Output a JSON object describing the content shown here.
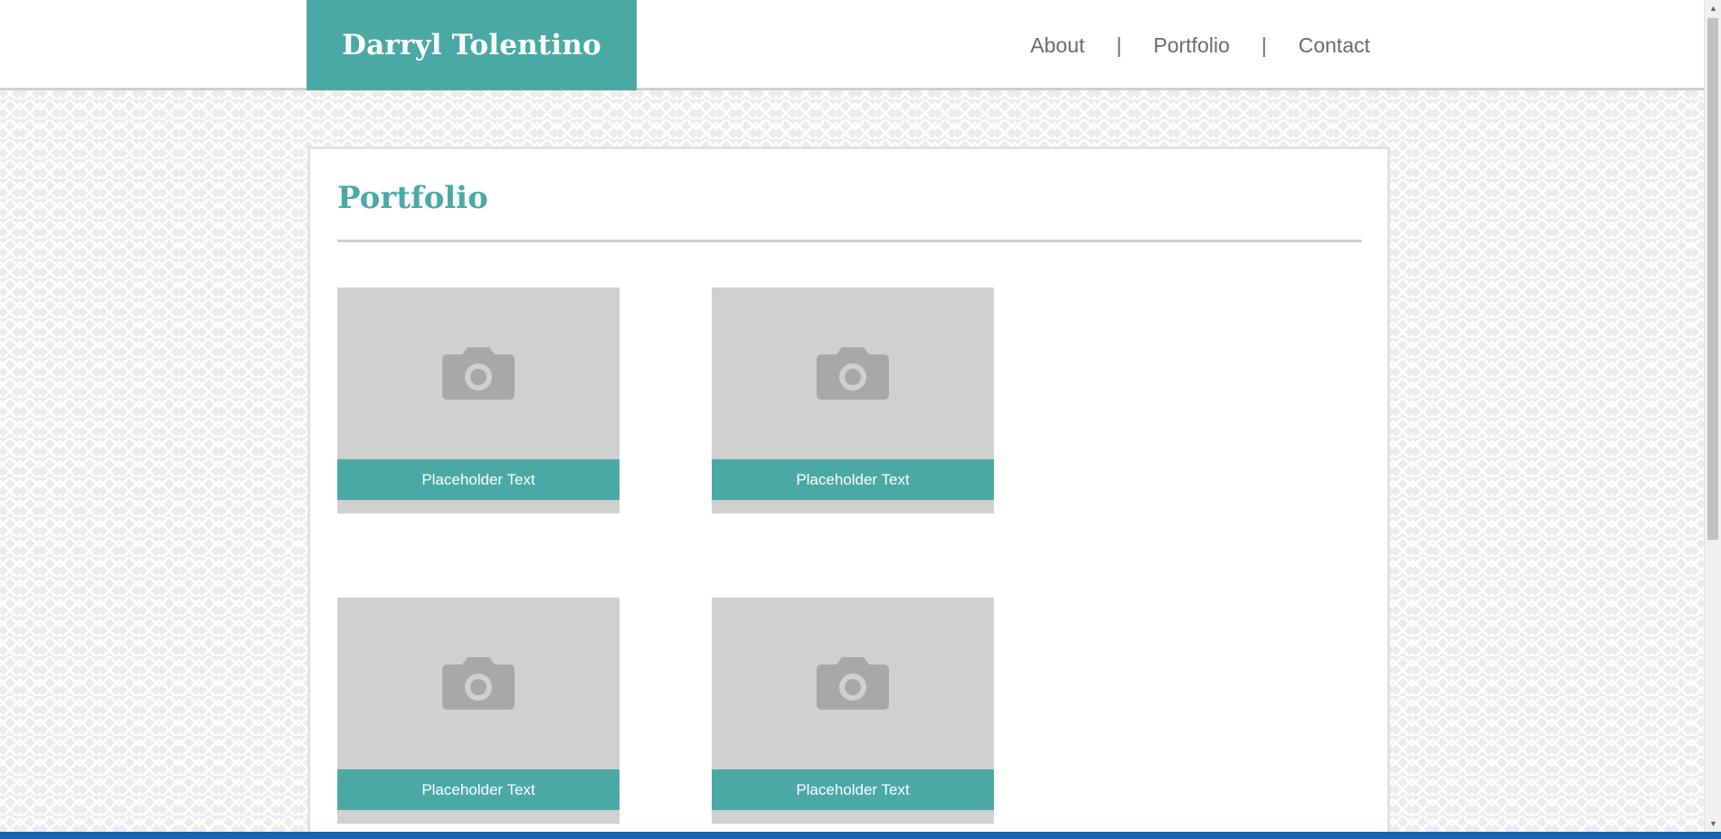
{
  "header": {
    "brand": "Darryl Tolentino",
    "nav": [
      {
        "label": "About"
      },
      {
        "label": "Portfolio"
      },
      {
        "label": "Contact"
      }
    ],
    "separator": "|"
  },
  "main": {
    "title": "Portfolio",
    "cards": [
      {
        "caption": "Placeholder Text",
        "icon": "camera-icon"
      },
      {
        "caption": "Placeholder Text",
        "icon": "camera-icon"
      },
      {
        "caption": "Placeholder Text",
        "icon": "camera-icon"
      },
      {
        "caption": "Placeholder Text",
        "icon": "camera-icon"
      }
    ]
  },
  "colors": {
    "accent": "#4aa9a5",
    "placeholder": "#d0d0d0",
    "nav_text": "#6b6b6b"
  }
}
